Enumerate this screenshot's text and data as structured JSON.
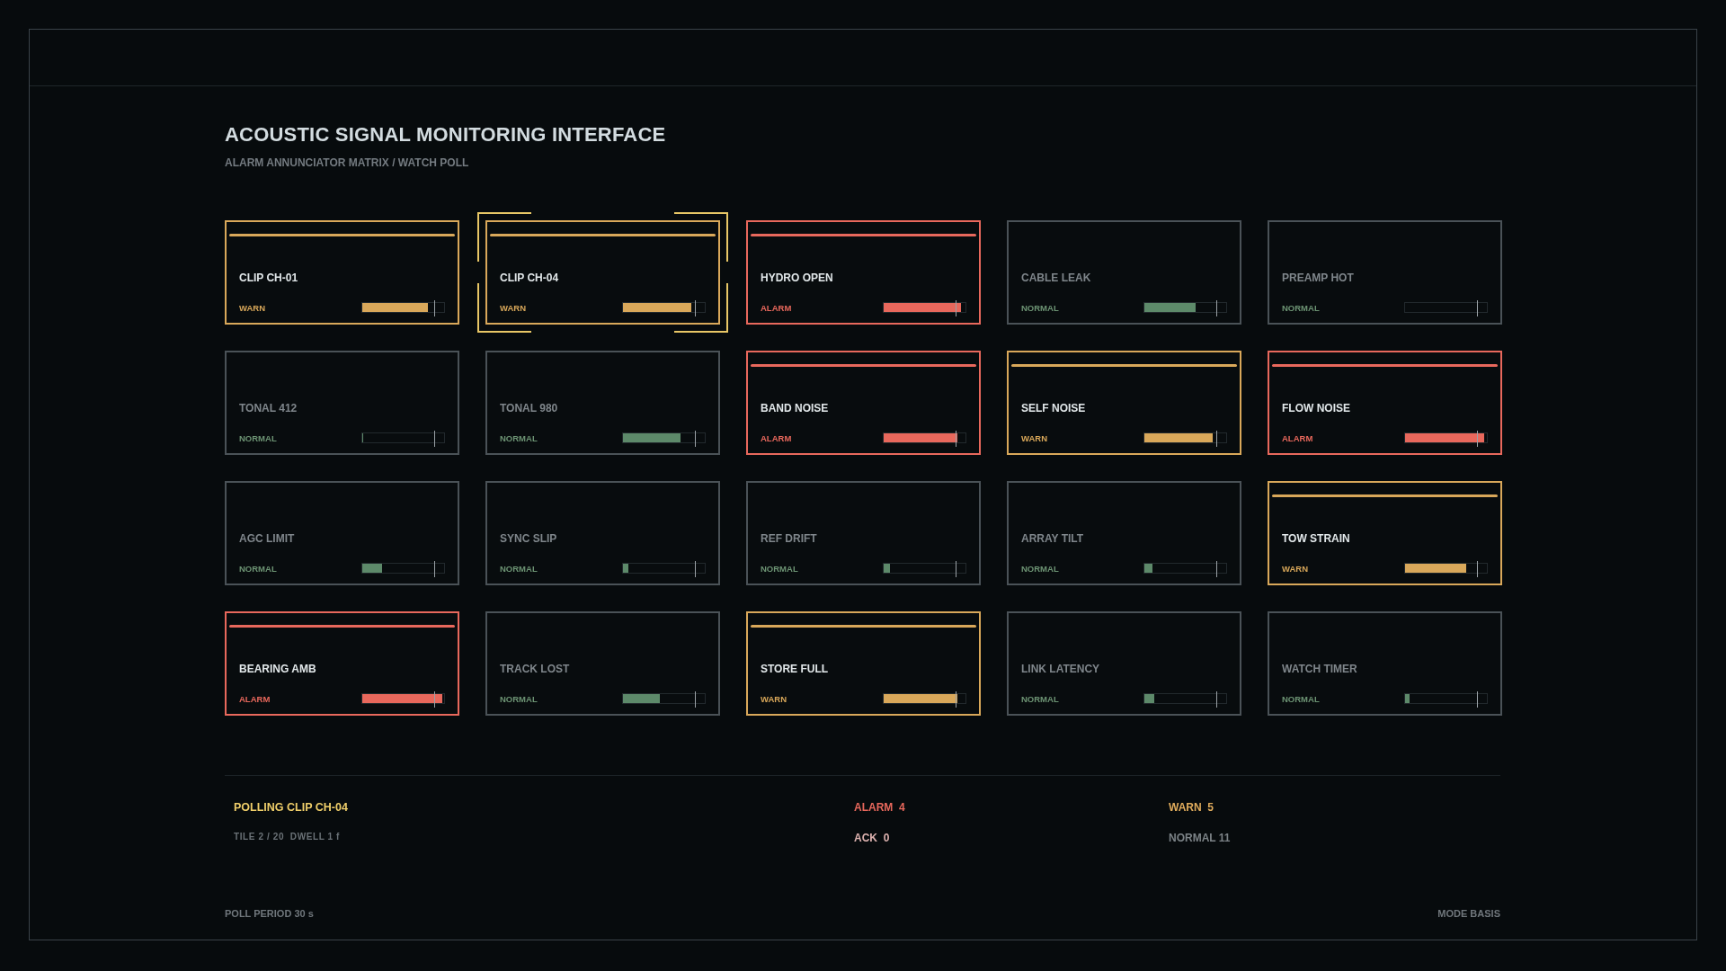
{
  "title": "ACOUSTIC SIGNAL MONITORING INTERFACE",
  "subtitle": "ALARM ANNUNCIATOR MATRIX / WATCH POLL",
  "tiles": [
    {
      "name": "CLIP CH-01",
      "status": "WARN",
      "kind": "warn",
      "level": 0.8,
      "selected": false
    },
    {
      "name": "CLIP CH-04",
      "status": "WARN",
      "kind": "warn",
      "level": 0.83,
      "selected": true
    },
    {
      "name": "HYDRO OPEN",
      "status": "ALARM",
      "kind": "alarm",
      "level": 0.95,
      "selected": false
    },
    {
      "name": "CABLE LEAK",
      "status": "NORMAL",
      "kind": "normal",
      "level": 0.63,
      "selected": false
    },
    {
      "name": "PREAMP HOT",
      "status": "NORMAL",
      "kind": "normal",
      "level": 0,
      "selected": false
    },
    {
      "name": "TONAL 412",
      "status": "NORMAL",
      "kind": "normal",
      "level": 0.01,
      "selected": false
    },
    {
      "name": "TONAL 980",
      "status": "NORMAL",
      "kind": "normal",
      "level": 0.7,
      "selected": false
    },
    {
      "name": "BAND NOISE",
      "status": "ALARM",
      "kind": "alarm",
      "level": 0.9,
      "selected": false
    },
    {
      "name": "SELF NOISE",
      "status": "WARN",
      "kind": "warn",
      "level": 0.84,
      "selected": false
    },
    {
      "name": "FLOW NOISE",
      "status": "ALARM",
      "kind": "alarm",
      "level": 0.97,
      "selected": false
    },
    {
      "name": "AGC LIMIT",
      "status": "NORMAL",
      "kind": "normal",
      "level": 0.24,
      "selected": false
    },
    {
      "name": "SYNC SLIP",
      "status": "NORMAL",
      "kind": "normal",
      "level": 0.07,
      "selected": false
    },
    {
      "name": "REF DRIFT",
      "status": "NORMAL",
      "kind": "normal",
      "level": 0.08,
      "selected": false
    },
    {
      "name": "ARRAY TILT",
      "status": "NORMAL",
      "kind": "normal",
      "level": 0.1,
      "selected": false
    },
    {
      "name": "TOW STRAIN",
      "status": "WARN",
      "kind": "warn",
      "level": 0.75,
      "selected": false
    },
    {
      "name": "BEARING AMB",
      "status": "ALARM",
      "kind": "alarm",
      "level": 0.98,
      "selected": false
    },
    {
      "name": "TRACK LOST",
      "status": "NORMAL",
      "kind": "normal",
      "level": 0.45,
      "selected": false
    },
    {
      "name": "STORE FULL",
      "status": "WARN",
      "kind": "warn",
      "level": 0.9,
      "selected": false
    },
    {
      "name": "LINK LATENCY",
      "status": "NORMAL",
      "kind": "normal",
      "level": 0.12,
      "selected": false
    },
    {
      "name": "WATCH TIMER",
      "status": "NORMAL",
      "kind": "normal",
      "level": 0.05,
      "selected": false
    }
  ],
  "poll": {
    "title": "POLLING CLIP CH-04",
    "detail": "TILE 2 / 20  DWELL 1 f"
  },
  "counts": [
    {
      "label": "ALARM  4",
      "kind": "alarm"
    },
    {
      "label": "WARN  5",
      "kind": "warn"
    },
    {
      "label": "ACK  0",
      "kind": "ack"
    },
    {
      "label": "NORMAL 11",
      "kind": "normal"
    }
  ],
  "footer": {
    "left": "POLL PERIOD 30 s",
    "right": "MODE BASIS"
  }
}
